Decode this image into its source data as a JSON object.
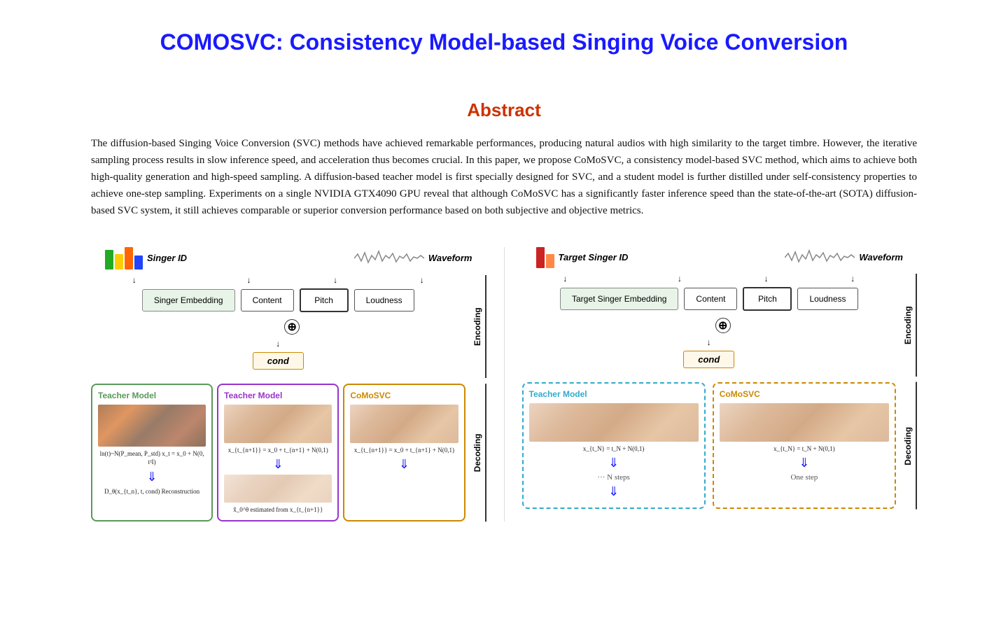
{
  "title": "COMOSVC: Consistency Model-based Singing Voice Conversion",
  "abstract": {
    "heading": "Abstract",
    "text": "The diffusion-based Singing Voice Conversion (SVC) methods have achieved remarkable performances, producing natural audios with high similarity to the target timbre. However, the iterative sampling process results in slow inference speed, and acceleration thus becomes crucial. In this paper, we propose CoMoSVC, a consistency model-based SVC method, which aims to achieve both high-quality generation and high-speed sampling. A diffusion-based teacher model is first specially designed for SVC, and a student model is further distilled under self-consistency properties to achieve one-step sampling. Experiments on a single NVIDIA GTX4090 GPU reveal that although CoMoSVC has a significantly faster inference speed than the state-of-the-art (SOTA) diffusion-based SVC system, it still achieves comparable or superior conversion performance based on both subjective and objective metrics."
  },
  "diagram": {
    "left": {
      "singer_id_label": "Singer ID",
      "waveform_label": "Waveform",
      "encoding_label": "Encoding",
      "decoding_label": "Decoding",
      "singer_embedding": "Singer\nEmbedding",
      "content": "Content",
      "pitch": "Pitch",
      "loudness": "Loudness",
      "cond": "cond",
      "teacher_model_1_label": "Teacher Model",
      "teacher_model_2_label": "Teacher Model",
      "comosvc_label": "CoMoSVC",
      "eq1": "ln(t)~N(P_mean, P_std)\nx_t = x_0 + N(0, t²I)",
      "eq2": "x_{t_{n+1}} = x_0 + t_{n+1} + N(0,1)",
      "eq3": "x_{t_{n+1}} = x_0 + t_{n+1} + N(0,1)",
      "reconstruction": "D_θ(x_{t_n}, t, cond)\nReconstruction",
      "estimated": "x̂_0^θ estimated from x_{t_{n+1}}"
    },
    "right": {
      "target_singer_id_label": "Target Singer ID",
      "waveform_label": "Waveform",
      "encoding_label": "Encoding",
      "decoding_label": "Decoding",
      "target_singer_embedding": "Target Singer\nEmbedding",
      "content": "Content",
      "pitch": "Pitch",
      "loudness": "Loudness",
      "cond": "cond",
      "teacher_model_label": "Teacher Model",
      "comosvc_label": "CoMoSVC",
      "eq_teacher": "x_{t_N} = t_N + N(0,1)",
      "eq_comosvc": "x_{t_N} = t_N + N(0,1)",
      "n_steps": "··· N steps",
      "one_step": "One\nstep"
    }
  }
}
